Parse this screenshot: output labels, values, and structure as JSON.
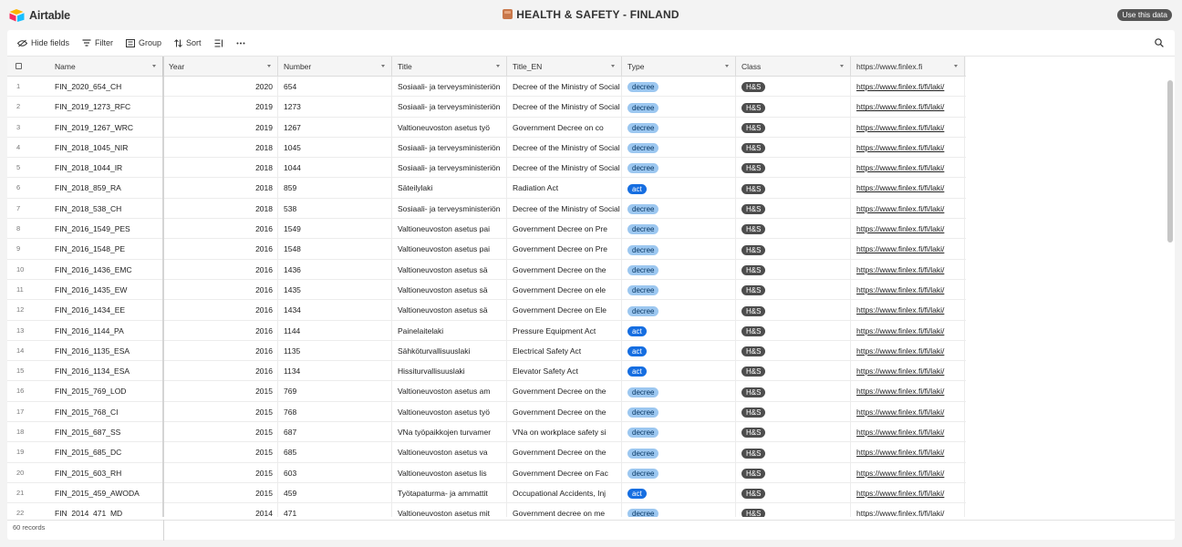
{
  "app": {
    "logo_text": "Airtable",
    "base_title": "HEALTH & SAFETY - FINLAND",
    "use_data_label": "Use this data"
  },
  "toolbar": {
    "hide_fields": "Hide fields",
    "filter": "Filter",
    "group": "Group",
    "sort": "Sort"
  },
  "columns": [
    "Name",
    "Year",
    "Number",
    "Title",
    "Title_EN",
    "Type",
    "Class",
    "https://www.finlex.fi"
  ],
  "rows": [
    {
      "idx": "1",
      "name": "FIN_2020_654_CH",
      "year": "2020",
      "number": "654",
      "title": "Sosiaali- ja terveysministeriön",
      "title_en": "Decree of the Ministry of Social",
      "type": "decree",
      "class": "H&S",
      "url": "https://www.finlex.fi/fi/laki/"
    },
    {
      "idx": "2",
      "name": "FIN_2019_1273_RFC",
      "year": "2019",
      "number": "1273",
      "title": "Sosiaali- ja terveysministeriön",
      "title_en": "Decree of the Ministry of Social",
      "type": "decree",
      "class": "H&S",
      "url": "https://www.finlex.fi/fi/laki/"
    },
    {
      "idx": "3",
      "name": "FIN_2019_1267_WRC",
      "year": "2019",
      "number": "1267",
      "title": "Valtioneuvoston asetus työ",
      "title_en": "Government Decree on co",
      "type": "decree",
      "class": "H&S",
      "url": "https://www.finlex.fi/fi/laki/"
    },
    {
      "idx": "4",
      "name": "FIN_2018_1045_NIR",
      "year": "2018",
      "number": "1045",
      "title": "Sosiaali- ja terveysministeriön",
      "title_en": "Decree of the Ministry of Social",
      "type": "decree",
      "class": "H&S",
      "url": "https://www.finlex.fi/fi/laki/"
    },
    {
      "idx": "5",
      "name": "FIN_2018_1044_IR",
      "year": "2018",
      "number": "1044",
      "title": "Sosiaali- ja terveysministeriön",
      "title_en": "Decree of the Ministry of Social",
      "type": "decree",
      "class": "H&S",
      "url": "https://www.finlex.fi/fi/laki/"
    },
    {
      "idx": "6",
      "name": "FIN_2018_859_RA",
      "year": "2018",
      "number": "859",
      "title": "Säteilylaki",
      "title_en": "Radiation Act",
      "type": "act",
      "class": "H&S",
      "url": "https://www.finlex.fi/fi/laki/"
    },
    {
      "idx": "7",
      "name": "FIN_2018_538_CH",
      "year": "2018",
      "number": "538",
      "title": "Sosiaali- ja terveysministeriön",
      "title_en": "Decree of the Ministry of Social",
      "type": "decree",
      "class": "H&S",
      "url": "https://www.finlex.fi/fi/laki/"
    },
    {
      "idx": "8",
      "name": "FIN_2016_1549_PES",
      "year": "2016",
      "number": "1549",
      "title": "Valtioneuvoston asetus pai",
      "title_en": "Government Decree on Pre",
      "type": "decree",
      "class": "H&S",
      "url": "https://www.finlex.fi/fi/laki/"
    },
    {
      "idx": "9",
      "name": "FIN_2016_1548_PE",
      "year": "2016",
      "number": "1548",
      "title": "Valtioneuvoston asetus pai",
      "title_en": "Government Decree on Pre",
      "type": "decree",
      "class": "H&S",
      "url": "https://www.finlex.fi/fi/laki/"
    },
    {
      "idx": "10",
      "name": "FIN_2016_1436_EMC",
      "year": "2016",
      "number": "1436",
      "title": "Valtioneuvoston asetus sä",
      "title_en": "Government Decree on the",
      "type": "decree",
      "class": "H&S",
      "url": "https://www.finlex.fi/fi/laki/"
    },
    {
      "idx": "11",
      "name": "FIN_2016_1435_EW",
      "year": "2016",
      "number": "1435",
      "title": "Valtioneuvoston asetus sä",
      "title_en": "Government Decree on ele",
      "type": "decree",
      "class": "H&S",
      "url": "https://www.finlex.fi/fi/laki/"
    },
    {
      "idx": "12",
      "name": "FIN_2016_1434_EE",
      "year": "2016",
      "number": "1434",
      "title": "Valtioneuvoston asetus sä",
      "title_en": "Government Decree on Ele",
      "type": "decree",
      "class": "H&S",
      "url": "https://www.finlex.fi/fi/laki/"
    },
    {
      "idx": "13",
      "name": "FIN_2016_1144_PA",
      "year": "2016",
      "number": "1144",
      "title": "Painelaitelaki",
      "title_en": "Pressure Equipment Act",
      "type": "act",
      "class": "H&S",
      "url": "https://www.finlex.fi/fi/laki/"
    },
    {
      "idx": "14",
      "name": "FIN_2016_1135_ESA",
      "year": "2016",
      "number": "1135",
      "title": "Sähköturvallisuuslaki",
      "title_en": "Electrical Safety Act",
      "type": "act",
      "class": "H&S",
      "url": "https://www.finlex.fi/fi/laki/"
    },
    {
      "idx": "15",
      "name": "FIN_2016_1134_ESA",
      "year": "2016",
      "number": "1134",
      "title": "Hissiturvallisuuslaki",
      "title_en": "Elevator Safety Act",
      "type": "act",
      "class": "H&S",
      "url": "https://www.finlex.fi/fi/laki/"
    },
    {
      "idx": "16",
      "name": "FIN_2015_769_LOD",
      "year": "2015",
      "number": "769",
      "title": "Valtioneuvoston asetus am",
      "title_en": "Government Decree on the",
      "type": "decree",
      "class": "H&S",
      "url": "https://www.finlex.fi/fi/laki/"
    },
    {
      "idx": "17",
      "name": "FIN_2015_768_CI",
      "year": "2015",
      "number": "768",
      "title": "Valtioneuvoston asetus työ",
      "title_en": "Government Decree on the",
      "type": "decree",
      "class": "H&S",
      "url": "https://www.finlex.fi/fi/laki/"
    },
    {
      "idx": "18",
      "name": "FIN_2015_687_SS",
      "year": "2015",
      "number": "687",
      "title": "VNa työpaikkojen turvamer",
      "title_en": "VNa on workplace safety si",
      "type": "decree",
      "class": "H&S",
      "url": "https://www.finlex.fi/fi/laki/"
    },
    {
      "idx": "19",
      "name": "FIN_2015_685_DC",
      "year": "2015",
      "number": "685",
      "title": "Valtioneuvoston asetus va",
      "title_en": "Government Decree on the",
      "type": "decree",
      "class": "H&S",
      "url": "https://www.finlex.fi/fi/laki/"
    },
    {
      "idx": "20",
      "name": "FIN_2015_603_RH",
      "year": "2015",
      "number": "603",
      "title": "Valtioneuvoston asetus lis",
      "title_en": "Government Decree on Fac",
      "type": "decree",
      "class": "H&S",
      "url": "https://www.finlex.fi/fi/laki/"
    },
    {
      "idx": "21",
      "name": "FIN_2015_459_AWODA",
      "year": "2015",
      "number": "459",
      "title": "Työtapaturma- ja ammattit",
      "title_en": "Occupational Accidents, Inj",
      "type": "act",
      "class": "H&S",
      "url": "https://www.finlex.fi/fi/laki/"
    },
    {
      "idx": "22",
      "name": "FIN_2014_471_MD",
      "year": "2014",
      "number": "471",
      "title": "Valtioneuvoston asetus mit",
      "title_en": "Government decree on me",
      "type": "decree",
      "class": "H&S",
      "url": "https://www.finlex.fi/fi/laki/"
    }
  ],
  "footer": {
    "records": "60 records"
  },
  "colors": {
    "decree": "#9cc7f0",
    "act": "#166ee1",
    "class": "#4d4d4d"
  }
}
